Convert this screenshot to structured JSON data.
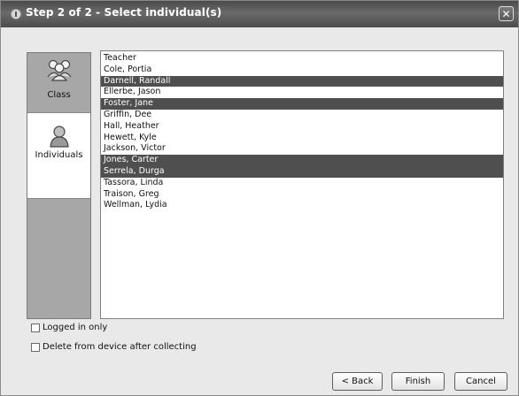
{
  "window": {
    "title": "Step 2 of 2 - Select individual(s)",
    "close_glyph": "✕"
  },
  "sidebar": {
    "items": [
      {
        "label": "Class",
        "icon": "group-icon",
        "selected": false
      },
      {
        "label": "Individuals",
        "icon": "person-icon",
        "selected": true
      }
    ]
  },
  "list": {
    "rows": [
      {
        "label": "Teacher",
        "selected": false
      },
      {
        "label": "Cole, Portia",
        "selected": false
      },
      {
        "label": "Darnell, Randall",
        "selected": true
      },
      {
        "label": "Ellerbe, Jason",
        "selected": false
      },
      {
        "label": "Foster, Jane",
        "selected": true
      },
      {
        "label": "Griffin, Dee",
        "selected": false
      },
      {
        "label": "Hall, Heather",
        "selected": false
      },
      {
        "label": "Hewett, Kyle",
        "selected": false
      },
      {
        "label": "Jackson, Victor",
        "selected": false
      },
      {
        "label": "Jones, Carter",
        "selected": true
      },
      {
        "label": "Serrela, Durga",
        "selected": true
      },
      {
        "label": "Tassora, Linda",
        "selected": false
      },
      {
        "label": "Traison, Greg",
        "selected": false
      },
      {
        "label": "Wellman, Lydia",
        "selected": false
      }
    ]
  },
  "options": {
    "logged_in_only": {
      "label": "Logged in only",
      "checked": false
    },
    "delete_after": {
      "label": "Delete from device after collecting",
      "checked": false
    }
  },
  "buttons": {
    "back": "< Back",
    "finish": "Finish",
    "cancel": "Cancel"
  }
}
